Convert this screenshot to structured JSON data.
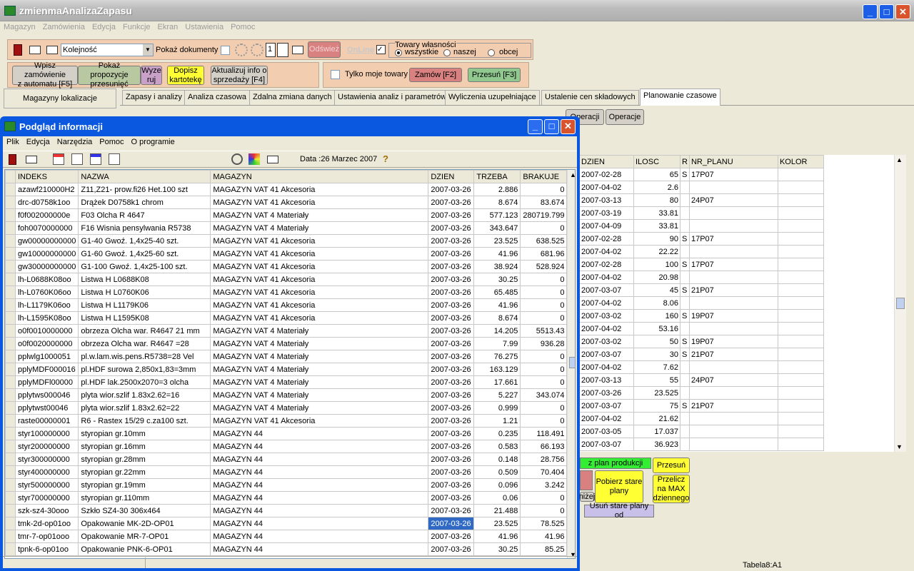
{
  "app": {
    "title": "zmienmaAnalizaZapasu"
  },
  "menu": [
    "Magazyn",
    "Zamówienia",
    "Edycja",
    "Funkcje",
    "Ekran",
    "Ustawienia",
    "Pomoc"
  ],
  "toolbar": {
    "order_select": "Kolejność",
    "show_docs": "Pokaż dokumenty",
    "num_field": "1",
    "refresh": "Odśwież",
    "online": "OnLine",
    "goods_group": "Towary własności",
    "radio_all": "wszystkie",
    "radio_ours": "naszej",
    "radio_foreign": "obcej"
  },
  "actions": {
    "write_orders": "Wpisz zamówienie\nz automatu [F5]",
    "show_proposals": "Pokaż propozycje\nprzesunięć",
    "wyzeruj": "Wyze\nruj",
    "dopisz": "Dopisz\nkartotekę",
    "aktualizuj": "Aktualizuj info o\nsprzedaży [F4]",
    "only_my": "Tylko moje towary",
    "zamow": "Zamów [F2]",
    "przesun": "Przesuń [F3]"
  },
  "left_panel": {
    "label": "Magazyny lokalizacje"
  },
  "tabs": [
    "Zapasy i analizy",
    "Analiza czasowa",
    "Zdalna zmiana danych",
    "Ustawienia analiz i parametrów",
    "Wyliczenia uzupełniające",
    "Ustalenie cen składowych",
    "Planowanie czasowe"
  ],
  "sub_buttons": {
    "operacji": "Operacji",
    "operacje": "Operacje"
  },
  "right_grid": {
    "columns": [
      "DZIEN",
      "ILOSC",
      "R",
      "NR_PLANU",
      "KOLOR"
    ],
    "rows": [
      [
        "2007-02-28",
        "65",
        "S",
        "17P07",
        ""
      ],
      [
        "2007-04-02",
        "2.6",
        "",
        "",
        ""
      ],
      [
        "2007-03-13",
        "80",
        "",
        "24P07",
        ""
      ],
      [
        "2007-03-19",
        "33.81",
        "",
        "",
        ""
      ],
      [
        "2007-04-09",
        "33.81",
        "",
        "",
        ""
      ],
      [
        "2007-02-28",
        "90",
        "S",
        "17P07",
        ""
      ],
      [
        "2007-04-02",
        "22.22",
        "",
        "",
        ""
      ],
      [
        "2007-02-28",
        "100",
        "S",
        "17P07",
        ""
      ],
      [
        "2007-04-02",
        "20.98",
        "",
        "",
        ""
      ],
      [
        "2007-03-07",
        "45",
        "S",
        "21P07",
        ""
      ],
      [
        "2007-04-02",
        "8.06",
        "",
        "",
        ""
      ],
      [
        "2007-03-02",
        "160",
        "S",
        "19P07",
        ""
      ],
      [
        "2007-04-02",
        "53.16",
        "",
        "",
        ""
      ],
      [
        "2007-03-02",
        "50",
        "S",
        "19P07",
        ""
      ],
      [
        "2007-03-07",
        "30",
        "S",
        "21P07",
        ""
      ],
      [
        "2007-04-02",
        "7.62",
        "",
        "",
        ""
      ],
      [
        "2007-03-13",
        "55",
        "",
        "24P07",
        ""
      ],
      [
        "2007-03-26",
        "23.525",
        "",
        "",
        ""
      ],
      [
        "2007-03-07",
        "75",
        "S",
        "21P07",
        ""
      ],
      [
        "2007-04-02",
        "21.62",
        "",
        "",
        ""
      ],
      [
        "2007-03-05",
        "17.037",
        "",
        "",
        ""
      ],
      [
        "2007-03-07",
        "36.923",
        "",
        "",
        ""
      ]
    ]
  },
  "bottom_buttons": {
    "plan": "z plan produkcji",
    "przesun": "Przesuń",
    "pobierz": "Pobierz stare\nplany",
    "przelicz": "Przelicz\nna MAX\ndziennego",
    "nizej": "niżej",
    "usun": "Usuń stare plany od"
  },
  "status_text": "Tabela8:A1",
  "child_window": {
    "title": "Podgląd informacji",
    "menu": [
      "Plik",
      "Edycja",
      "Narzędzia",
      "Pomoc",
      "O programie"
    ],
    "date_label": "Data :26 Marzec 2007",
    "columns": [
      "INDEKS",
      "NAZWA",
      "MAGAZYN",
      "DZIEN",
      "TRZEBA",
      "BRAKUJE"
    ],
    "rows": [
      [
        "azawf210000H2",
        "Z11,Z21- prow.fi26 Het.100 szt",
        "MAGAZYN VAT 41 Akcesoria",
        "2007-03-26",
        "2.886",
        "0"
      ],
      [
        "drc-d0758k1oo",
        "Drążek D0758k1 chrom",
        "MAGAZYN VAT 41 Akcesoria",
        "2007-03-26",
        "8.674",
        "83.674"
      ],
      [
        "f0f002000000e",
        "F03 Olcha R 4647",
        "MAGAZYN VAT 4 Materiały",
        "2007-03-26",
        "577.123",
        "280719.799"
      ],
      [
        "foh0070000000",
        "F16 Wisnia pensylwania R5738",
        "MAGAZYN VAT 4 Materiały",
        "2007-03-26",
        "343.647",
        "0"
      ],
      [
        "gw00000000000",
        "G1-40 Gwoź. 1,4x25-40 szt.",
        "MAGAZYN VAT 41 Akcesoria",
        "2007-03-26",
        "23.525",
        "638.525"
      ],
      [
        "gw10000000000",
        "G1-60 Gwoź. 1,4x25-60 szt.",
        "MAGAZYN VAT 41 Akcesoria",
        "2007-03-26",
        "41.96",
        "681.96"
      ],
      [
        "gw30000000000",
        "G1-100 Gwoź. 1,4x25-100 szt.",
        "MAGAZYN VAT 41 Akcesoria",
        "2007-03-26",
        "38.924",
        "528.924"
      ],
      [
        "lh-L0688K08oo",
        "Listwa H L0688K08",
        "MAGAZYN VAT 41 Akcesoria",
        "2007-03-26",
        "30.25",
        "0"
      ],
      [
        "lh-L0760K06oo",
        "Listwa H L0760K06",
        "MAGAZYN VAT 41 Akcesoria",
        "2007-03-26",
        "65.485",
        "0"
      ],
      [
        "lh-L1179K06oo",
        "Listwa H L1179K06",
        "MAGAZYN VAT 41 Akcesoria",
        "2007-03-26",
        "41.96",
        "0"
      ],
      [
        "lh-L1595K08oo",
        "Listwa H L1595K08",
        "MAGAZYN VAT 41 Akcesoria",
        "2007-03-26",
        "8.674",
        "0"
      ],
      [
        "o0f0010000000",
        "obrzeza Olcha war. R4647 21 mm",
        "MAGAZYN VAT 4 Materiały",
        "2007-03-26",
        "14.205",
        "5513.43"
      ],
      [
        "o0f0020000000",
        "obrzeza Olcha war. R4647 =28",
        "MAGAZYN VAT 4 Materiały",
        "2007-03-26",
        "7.99",
        "936.28"
      ],
      [
        "pplwlg1000051",
        "pl.w.lam.wis.pens.R5738=28 Vel",
        "MAGAZYN VAT 4 Materiały",
        "2007-03-26",
        "76.275",
        "0"
      ],
      [
        "pplyMDF000016",
        "pl.HDF surowa 2,850x1,83=3mm",
        "MAGAZYN VAT 4 Materiały",
        "2007-03-26",
        "163.129",
        "0"
      ],
      [
        "pplyMDFl00000",
        "pl.HDF lak.2500x2070=3 olcha",
        "MAGAZYN VAT 4 Materiały",
        "2007-03-26",
        "17.661",
        "0"
      ],
      [
        "pplytws000046",
        "plyta wior.szlif 1.83x2.62=16",
        "MAGAZYN VAT 4 Materiały",
        "2007-03-26",
        "5.227",
        "343.074"
      ],
      [
        "pplytwst00046",
        "plyta wior.szlif 1.83x2.62=22",
        "MAGAZYN VAT 4 Materiały",
        "2007-03-26",
        "0.999",
        "0"
      ],
      [
        "raste00000001",
        "R6 - Rastex 15/29 c.za100 szt.",
        "MAGAZYN VAT 41 Akcesoria",
        "2007-03-26",
        "1.21",
        "0"
      ],
      [
        "styr100000000",
        "styropian gr.10mm",
        "MAGAZYN 44",
        "2007-03-26",
        "0.235",
        "118.491"
      ],
      [
        "styr200000000",
        "styropian gr.16mm",
        "MAGAZYN 44",
        "2007-03-26",
        "0.583",
        "66.193"
      ],
      [
        "styr300000000",
        "styropian gr.28mm",
        "MAGAZYN 44",
        "2007-03-26",
        "0.148",
        "28.756"
      ],
      [
        "styr400000000",
        "styropian gr.22mm",
        "MAGAZYN 44",
        "2007-03-26",
        "0.509",
        "70.404"
      ],
      [
        "styr500000000",
        "styropian gr.19mm",
        "MAGAZYN 44",
        "2007-03-26",
        "0.096",
        "3.242"
      ],
      [
        "styr700000000",
        "styropian gr.110mm",
        "MAGAZYN 44",
        "2007-03-26",
        "0.06",
        "0"
      ],
      [
        "szk-sz4-30ooo",
        "Szkło SZ4-30 306x464",
        "MAGAZYN 44",
        "2007-03-26",
        "21.488",
        "0"
      ],
      [
        "tmk-2d-op01oo",
        "Opakowanie MK-2D-OP01",
        "MAGAZYN 44",
        "2007-03-26",
        "23.525",
        "78.525"
      ],
      [
        "tmr-7-op01ooo",
        "Opakowanie MR-7-OP01",
        "MAGAZYN 44",
        "2007-03-26",
        "41.96",
        "41.96"
      ],
      [
        "tpnk-6-op01oo",
        "Opakowanie PNK-6-OP01",
        "MAGAZYN 44",
        "2007-03-26",
        "30.25",
        "85.25"
      ]
    ],
    "selected_row": 26
  },
  "colors": {
    "toolbar_bg": "#f3cdb0",
    "xp_blue": "#0a58e0",
    "yellow": "#ffff33",
    "green": "#33ee33",
    "selection": "#316ac5"
  }
}
